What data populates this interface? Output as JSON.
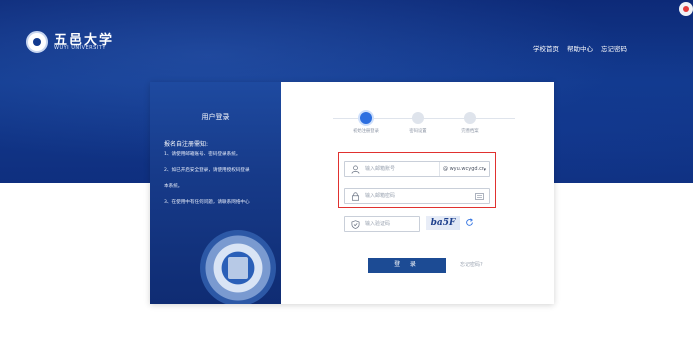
{
  "header": {
    "logo_cn": "五邑大学",
    "logo_en": "WUYI UNIVERSITY",
    "nav": [
      "学校首页",
      "帮助中心",
      "忘记密码"
    ]
  },
  "left_panel": {
    "title": "用户登录",
    "notice_title": "报名自注册需知:",
    "notices": [
      "1、请使用邮箱账号、密码登录系统。",
      "2、如已开启安全登录，请使用授权码登录",
      "本系统。",
      "3、在使用中有任何问题，请联系网络中心"
    ]
  },
  "steps": [
    "初始注册登录",
    "密码设置",
    "完善档案"
  ],
  "form": {
    "account_placeholder": "输入邮箱账号",
    "domain": "@ wyu.wcygd.cr",
    "password_placeholder": "输入邮箱密码",
    "captcha_placeholder": "输入验证码",
    "captcha_text": "ba5F",
    "login_label": "登 录",
    "forgot_label": "忘记密码?"
  },
  "colors": {
    "banner": "#123a8e",
    "accent": "#2d6fe0",
    "button": "#1c4b94",
    "highlight": "#e0312f"
  }
}
